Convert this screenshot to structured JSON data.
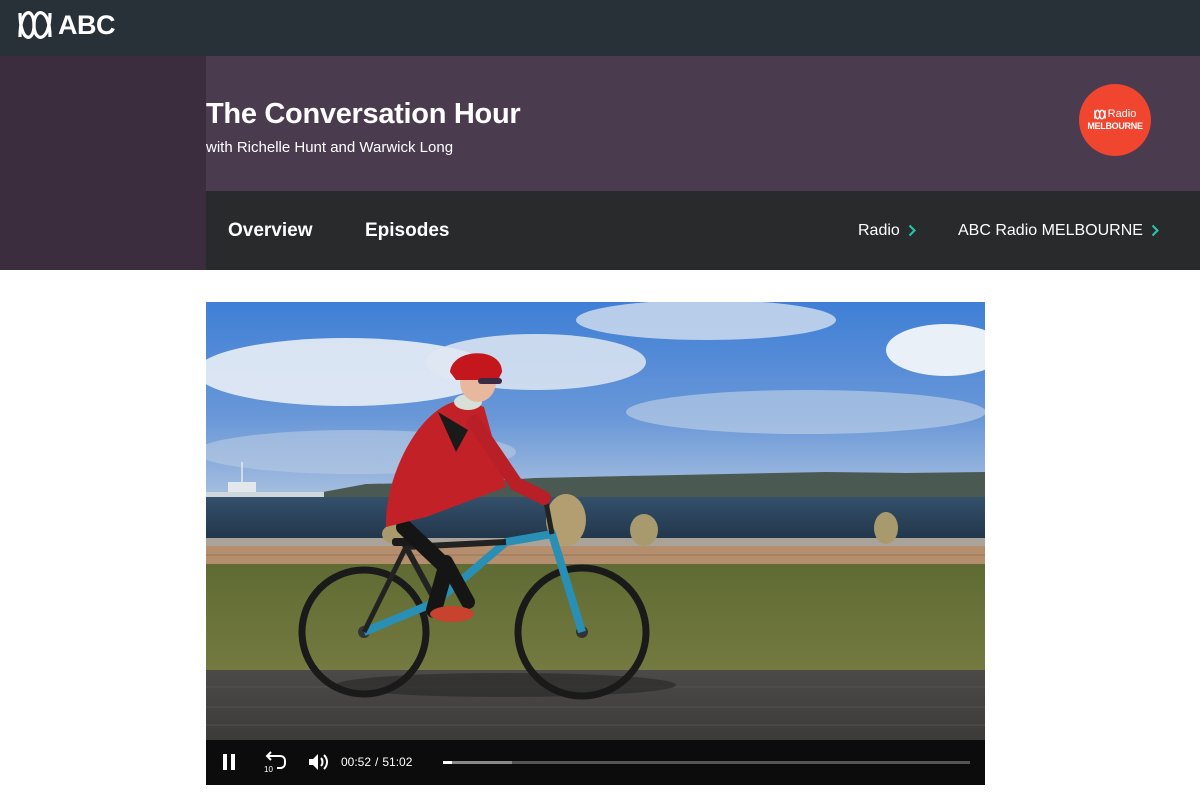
{
  "header": {
    "logo_text": "ABC",
    "logo_icon": "abc-lissajous-icon"
  },
  "show": {
    "title": "The Conversation Hour",
    "subtitle": "with Richelle Hunt and Warwick Long",
    "station_badge": {
      "line1": "Radio",
      "line2": "MELBOURNE",
      "color": "#f0462f"
    }
  },
  "nav": {
    "tabs": [
      {
        "label": "Overview"
      },
      {
        "label": "Episodes"
      }
    ],
    "breadcrumbs": [
      {
        "label": "Radio",
        "icon": "chevron-right-icon"
      },
      {
        "label": "ABC Radio MELBOURNE",
        "icon": "chevron-right-icon"
      }
    ],
    "accent_color": "#28c3a5"
  },
  "player": {
    "current_time": "00:52",
    "separator": "/",
    "duration": "51:02",
    "progress_fraction": 0.017,
    "buffered_fraction": 0.13,
    "rewind_seconds": "10",
    "pause_icon": "pause-icon",
    "rewind_icon": "rewind-10-icon",
    "volume_icon": "volume-icon"
  }
}
